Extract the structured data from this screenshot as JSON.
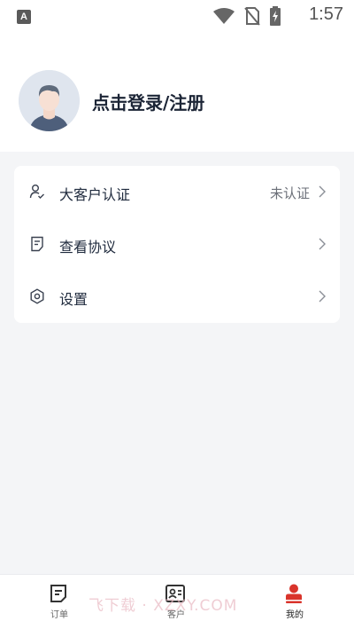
{
  "status_bar": {
    "time": "1:57",
    "app_icon_letter": "A"
  },
  "profile": {
    "login_prompt": "点击登录/注册"
  },
  "menu": {
    "items": [
      {
        "label": "大客户认证",
        "value": "未认证",
        "icon": "user-check-icon"
      },
      {
        "label": "查看协议",
        "value": "",
        "icon": "document-icon"
      },
      {
        "label": "设置",
        "value": "",
        "icon": "settings-hexagon-icon"
      }
    ]
  },
  "tab_bar": {
    "tabs": [
      {
        "label": "订单",
        "icon": "order-icon",
        "active": false
      },
      {
        "label": "客户",
        "icon": "customer-card-icon",
        "active": false
      },
      {
        "label": "我的",
        "icon": "profile-person-icon",
        "active": true
      }
    ],
    "active_color": "#d9342b"
  },
  "watermark": {
    "text": "飞下载 · XZXY.COM"
  },
  "colors": {
    "background": "#f4f5f7",
    "card": "#ffffff",
    "accent": "#d9342b"
  }
}
